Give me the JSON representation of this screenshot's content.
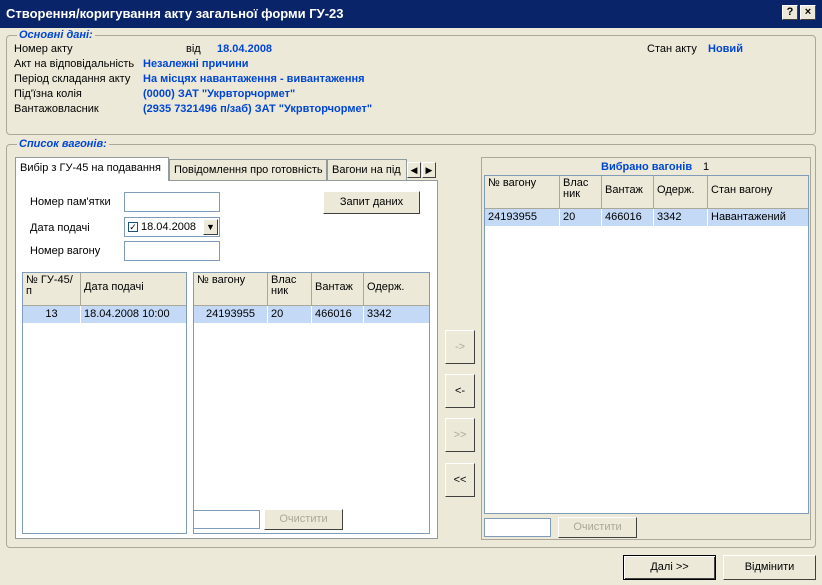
{
  "window": {
    "title": "Створення/коригування акту загальної форми ГУ-23",
    "help_glyph": "?",
    "close_glyph": "×"
  },
  "main_info": {
    "legend": "Основні дані:",
    "act_number_label": "Номер акту",
    "from_label": "від",
    "act_date": "18.04.2008",
    "act_state_label": "Стан акту",
    "act_state": "Новий",
    "responsibility_label": "Акт на відповідальність",
    "responsibility": "Незалежні причини",
    "period_label": "Період складання акту",
    "period": "На місцях навантаження - вивантаження",
    "track_label": "Під'їзна колія",
    "track": "(0000) ЗАТ \"Укрвторчормет\"",
    "owner_label": "Вантажовласник",
    "owner": "(2935 7321496 п/заб) ЗАТ \"Укрвторчормет\""
  },
  "wagons": {
    "legend": "Список вагонів:",
    "tabs": [
      {
        "label": "Вибір з ГУ-45 на подавання",
        "active": true
      },
      {
        "label": "Повідомлення про готовність",
        "active": false
      },
      {
        "label": "Вагони на під",
        "active": false
      }
    ],
    "tab_scroll_left": "◀",
    "tab_scroll_right": "▶",
    "memo_label": "Номер пам'ятки",
    "memo_value": "",
    "date_label": "Дата подачі",
    "date_checked": "✓",
    "date_value": "18.04.2008",
    "dropdown_glyph": "▼",
    "wagon_label": "Номер вагону",
    "wagon_value": "",
    "query_button": "Запит даних",
    "gu45_table": {
      "headers": [
        "№ ГУ-45/п",
        "Дата подачі"
      ],
      "rows": [
        [
          "13",
          "18.04.2008 10:00"
        ]
      ]
    },
    "wagon_table": {
      "headers": [
        "№ вагону",
        "Влас ник",
        "Вантаж",
        "Одерж."
      ],
      "rows": [
        [
          "24193955",
          "20",
          "466016",
          "3342"
        ]
      ]
    },
    "filter_left": "",
    "clear_left": "Очистити"
  },
  "transfer": {
    "add_one": "->",
    "remove_one": "<-",
    "add_all": ">>",
    "remove_all": "<<"
  },
  "selected": {
    "title": "Вибрано вагонів",
    "count": "1",
    "table": {
      "headers": [
        "№ вагону",
        "Влас ник",
        "Вантаж",
        "Одерж.",
        "Стан вагону"
      ],
      "rows": [
        [
          "24193955",
          "20",
          "466016",
          "3342",
          "Навантажений"
        ]
      ]
    },
    "filter": "",
    "clear": "Очистити"
  },
  "footer": {
    "next": "Далі >>",
    "cancel": "Відмінити"
  },
  "colors": {
    "titlebar": "#0a246a",
    "accent": "#0046d5",
    "selected_row": "#c3d9f5",
    "window_bg": "#ece9d8"
  }
}
